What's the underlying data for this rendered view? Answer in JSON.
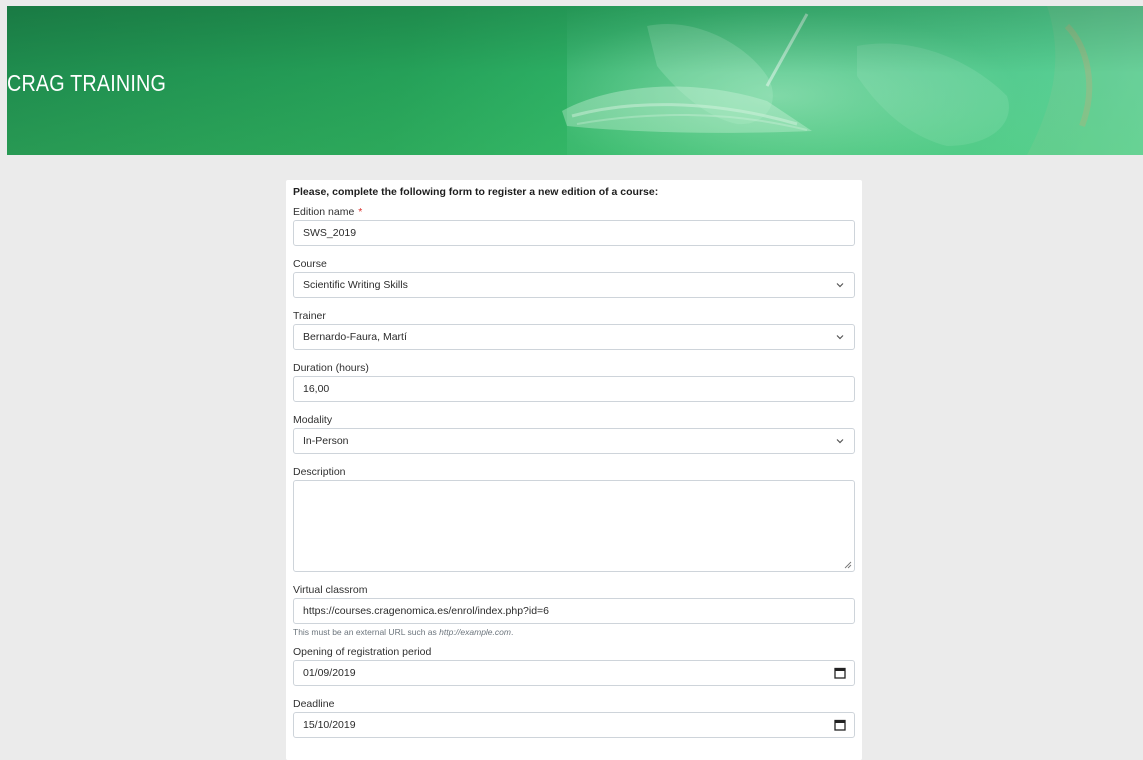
{
  "header": {
    "site_title": "CRAG TRAINING"
  },
  "form": {
    "intro": "Please, complete the following form to register a new edition of a course:",
    "required_marker": "*",
    "edition_name": {
      "label": "Edition name",
      "value": "SWS_2019"
    },
    "course": {
      "label": "Course",
      "value": "Scientific Writing Skills"
    },
    "trainer": {
      "label": "Trainer",
      "value": "Bernardo-Faura, Martí"
    },
    "duration": {
      "label": "Duration (hours)",
      "value": "16,00"
    },
    "modality": {
      "label": "Modality",
      "value": "In-Person"
    },
    "description": {
      "label": "Description",
      "value": ""
    },
    "virtual_classroom": {
      "label": "Virtual classrom",
      "value": "https://courses.cragenomica.es/enrol/index.php?id=6",
      "help_prefix": "This must be an external URL such as ",
      "help_example": "http://example.com",
      "help_suffix": "."
    },
    "registration_opening": {
      "label": "Opening of registration period",
      "value": "01/09/2019"
    },
    "deadline": {
      "label": "Deadline",
      "value": "15/10/2019"
    }
  },
  "icons": {
    "select": "chevron-down-icon",
    "date": "calendar-icon",
    "textarea": "resize-grip-icon"
  },
  "colors": {
    "banner_green": "#25a058",
    "page_background": "#ebebeb",
    "required": "#d9302b"
  }
}
